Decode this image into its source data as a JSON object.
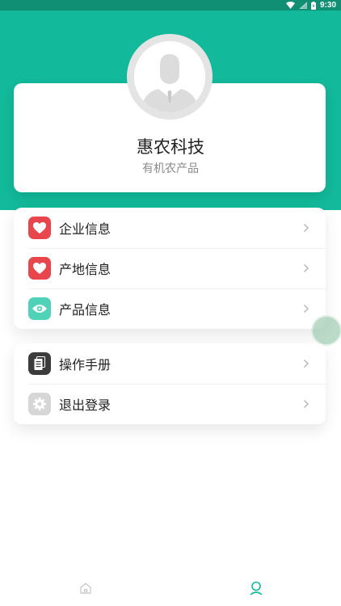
{
  "status_bar": {
    "time": "9:30",
    "icons": [
      "wifi-icon",
      "signal-icon",
      "battery-icon"
    ]
  },
  "colors": {
    "header": "#12b99a",
    "status_bar": "#108f74",
    "heart_red": "#e8454d",
    "eye_teal": "#4fd2b8",
    "manual_dark": "#3c3c3c",
    "gear_gray": "#d6d6d6",
    "tab_active": "#12b99a",
    "tab_inactive": "#c4c4c4"
  },
  "profile": {
    "name": "惠农科技",
    "subtitle": "有机农产品",
    "avatar_icon": "person-avatar-icon"
  },
  "menu_groups": [
    {
      "items": [
        {
          "label": "企业信息",
          "icon": "heart-icon"
        },
        {
          "label": "产地信息",
          "icon": "heart-icon"
        },
        {
          "label": "产品信息",
          "icon": "eye-icon"
        }
      ]
    },
    {
      "items": [
        {
          "label": "操作手册",
          "icon": "document-icon"
        },
        {
          "label": "退出登录",
          "icon": "gear-icon"
        }
      ]
    }
  ],
  "tab_bar": {
    "tabs": [
      {
        "icon": "home-icon",
        "active": false
      },
      {
        "icon": "user-icon",
        "active": true
      }
    ]
  }
}
